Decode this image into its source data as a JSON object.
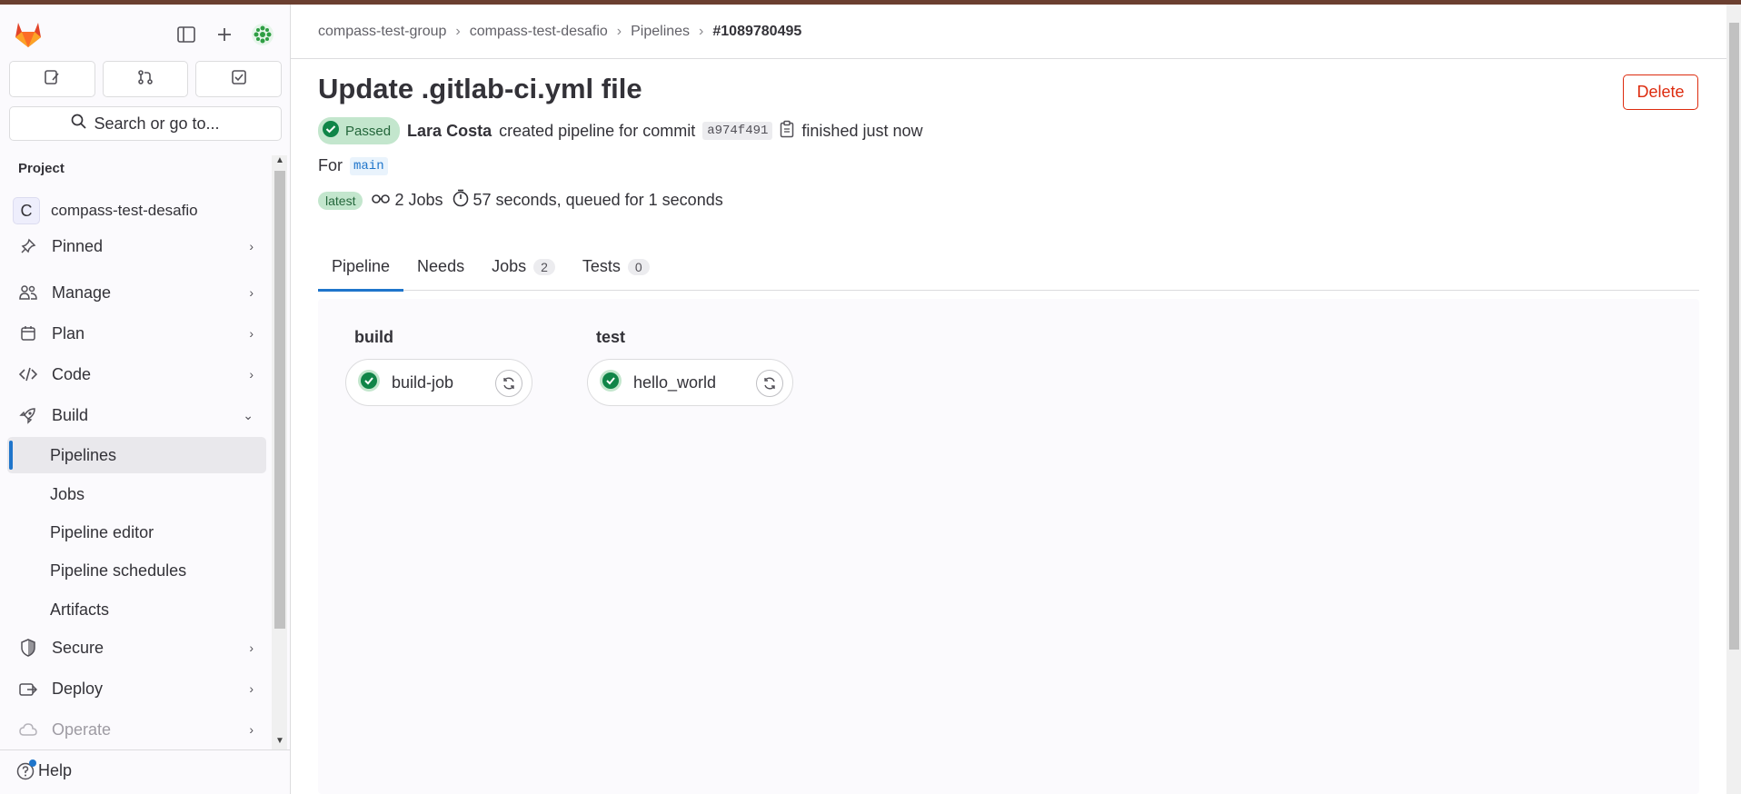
{
  "sidebar": {
    "section_title": "Project",
    "project": {
      "avatar_letter": "C",
      "name": "compass-test-desafio"
    },
    "search_placeholder": "Search or go to...",
    "items": [
      {
        "label": "Pinned",
        "icon": "pin-icon"
      },
      {
        "label": "Manage",
        "icon": "users-icon"
      },
      {
        "label": "Plan",
        "icon": "calendar-icon"
      },
      {
        "label": "Code",
        "icon": "code-icon"
      },
      {
        "label": "Build",
        "icon": "rocket-icon"
      }
    ],
    "build_sub": [
      "Pipelines",
      "Jobs",
      "Pipeline editor",
      "Pipeline schedules",
      "Artifacts"
    ],
    "lower_items": [
      {
        "label": "Secure",
        "icon": "shield-icon"
      },
      {
        "label": "Deploy",
        "icon": "deploy-icon"
      },
      {
        "label": "Operate",
        "icon": "cloud-icon"
      }
    ],
    "help_label": "Help"
  },
  "breadcrumb": [
    "compass-test-group",
    "compass-test-desafio",
    "Pipelines",
    "#1089780495"
  ],
  "pipeline": {
    "title": "Update .gitlab-ci.yml file",
    "status": "Passed",
    "author": "Lara Costa",
    "created_text": "created pipeline for commit",
    "sha": "a974f491",
    "finished_text": "finished just now",
    "for_label": "For",
    "branch": "main",
    "latest_badge": "latest",
    "jobs_text": "2 Jobs",
    "duration_text": "57 seconds, queued for 1 seconds",
    "delete_label": "Delete"
  },
  "tabs": [
    {
      "label": "Pipeline",
      "count": null
    },
    {
      "label": "Needs",
      "count": null
    },
    {
      "label": "Jobs",
      "count": "2"
    },
    {
      "label": "Tests",
      "count": "0"
    }
  ],
  "stages": [
    {
      "name": "build",
      "jobs": [
        "build-job"
      ]
    },
    {
      "name": "test",
      "jobs": [
        "hello_world"
      ]
    }
  ],
  "colors": {
    "accent": "#1f75cb",
    "success": "#108548",
    "danger": "#dd2b0e"
  }
}
